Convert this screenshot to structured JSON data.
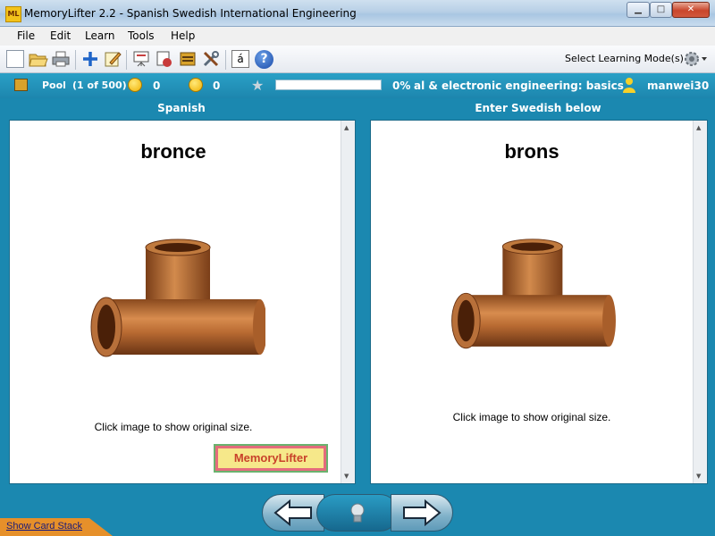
{
  "window": {
    "title": "MemoryLifter 2.2 - Spanish Swedish International Engineering",
    "app_icon_text": "ML",
    "minimize": "▁",
    "maximize": "□",
    "close": "✕"
  },
  "menu": [
    "File",
    "Edit",
    "Learn",
    "Tools",
    "Help"
  ],
  "toolbar": {
    "icons": [
      "new-icon",
      "open-icon",
      "print-icon",
      "add-icon",
      "edit-icon",
      "presentation-icon",
      "card-stack-icon",
      "cards-icon",
      "tools-icon",
      "character-map-icon",
      "help-icon"
    ],
    "special_char": "á",
    "help_char": "?",
    "mode_label": "Select Learning Mode(s)"
  },
  "status": {
    "pool_label": "Pool",
    "pool_count": "(1 of 500)",
    "known_count": "0",
    "unknown_count": "0",
    "progress_text": "0%",
    "progress_value": 0,
    "dictionary_title": "al & electronic engineering: basics",
    "username": "manwei30"
  },
  "question": {
    "header": "Spanish",
    "word": "bronce",
    "caption": "Click image to show original size.",
    "logo_text": "MemoryLifter"
  },
  "answer": {
    "header": "Enter Swedish below",
    "word": "brons",
    "caption": "Click image to show original size."
  },
  "bottom": {
    "show_stack": "Show Card Stack"
  },
  "colors": {
    "accent_blue": "#1b88b0",
    "copper": "#b4692e"
  }
}
